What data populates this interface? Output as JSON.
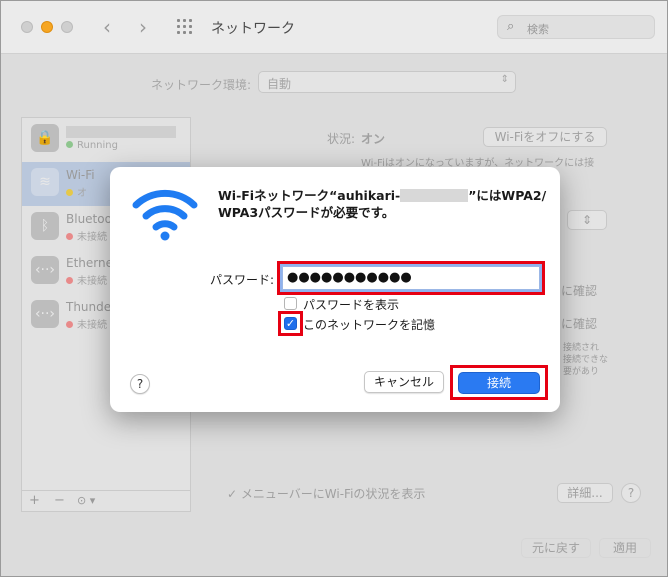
{
  "window": {
    "title": "ネットワーク",
    "search_placeholder": "検索"
  },
  "background": {
    "location_label": "ネットワーク環境:",
    "location_value": "自動",
    "sidebar": [
      {
        "name": "",
        "status": "Running",
        "status_color": "#8ec58e"
      },
      {
        "name": "Wi-Fi",
        "status": "オ",
        "status_color": "#e5c84a"
      },
      {
        "name": "Bluetooth",
        "status": "未接続",
        "status_color": "#e88a8a"
      },
      {
        "name": "Ethernet",
        "status": "未接続",
        "status_color": "#e88a8a"
      },
      {
        "name": "Thunder",
        "status": "未接続",
        "status_color": "#e88a8a"
      }
    ],
    "status_label": "状況:",
    "status_value": "オン",
    "wifi_off_button": "Wi-Fiをオフにする",
    "status_desc": "Wi-Fiはオンになっていますが、ネットワークには接",
    "confirm1": "に確認",
    "confirm2": "に確認",
    "side_note": [
      "接続され",
      "接続できな",
      "要があり"
    ],
    "menubar_checkbox": "メニューバーにWi-Fiの状況を表示",
    "detail_button": "詳細...",
    "help": "?",
    "revert_button": "元に戻す",
    "apply_button": "適用",
    "bottom_controls": [
      "+",
      "−",
      "⊙ ▾"
    ]
  },
  "dialog": {
    "title_prefix": "Wi-Fiネットワーク“auhikari-",
    "title_suffix": "”にはWPA2/",
    "title_line2": "WPA3パスワードが必要です。",
    "password_label": "パスワード:",
    "password_value": "●●●●●●●●●●●",
    "show_password_label": "パスワードを表示",
    "show_password_checked": false,
    "remember_label": "このネットワークを記憶",
    "remember_checked": true,
    "check_mark": "✓",
    "help_label": "?",
    "cancel_label": "キャンセル",
    "connect_label": "接続"
  },
  "colors": {
    "highlight": "#e60012",
    "accent": "#2a7af2",
    "wifi_icon": "#1f7cf2"
  }
}
